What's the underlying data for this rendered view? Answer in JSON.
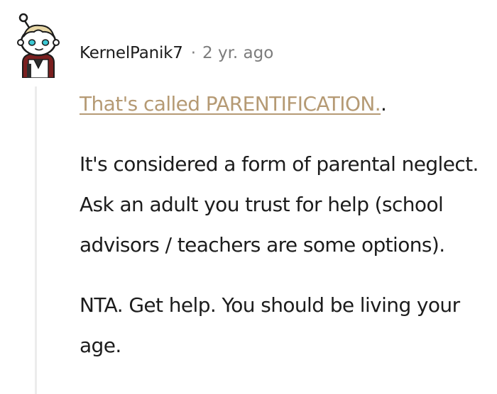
{
  "comment": {
    "author": "KernelPanik7",
    "separator": "·",
    "timestamp": "2 yr. ago",
    "avatar": "snoo-avatar",
    "link_text": "That's called PARENTIFICATION.",
    "link_trailing": ".",
    "paragraphs": [
      "It's considered a form of parental neglect. Ask an adult you trust for help (school advisors / teachers are some options).",
      "NTA. Get help. You should be living your age."
    ]
  },
  "colors": {
    "link": "#b59a74",
    "text": "#1c1c1c",
    "meta": "#7c7c7c",
    "thread_line": "#ececec"
  }
}
